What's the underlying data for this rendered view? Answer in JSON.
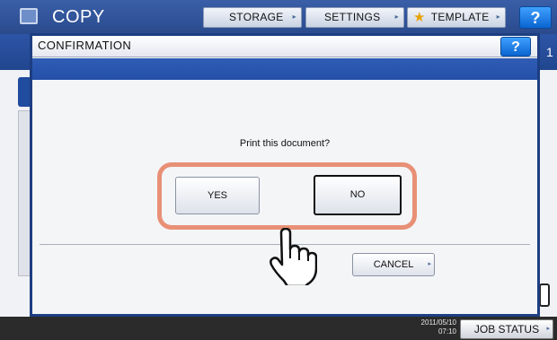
{
  "app": {
    "title": "COPY",
    "toolbar": {
      "storage_label": "STORAGE",
      "settings_label": "SETTINGS",
      "template_label": "TEMPLATE",
      "help_label": "?"
    },
    "side_number": "1"
  },
  "dialog": {
    "title": "CONFIRMATION",
    "help_label": "?",
    "message": "Print this document?",
    "yes_label": "YES",
    "no_label": "NO",
    "cancel_label": "CANCEL"
  },
  "status_bar": {
    "date": "2011/05/10",
    "time": "07:10",
    "job_status_label": "JOB STATUS"
  },
  "colors": {
    "header_blue": "#2d55a6",
    "help_blue": "#0a64d0",
    "highlight_orange": "#e89076"
  },
  "icons": [
    "copy-app-icon",
    "star-icon",
    "help-icon",
    "pointer-hand-icon",
    "arrow-icon"
  ]
}
